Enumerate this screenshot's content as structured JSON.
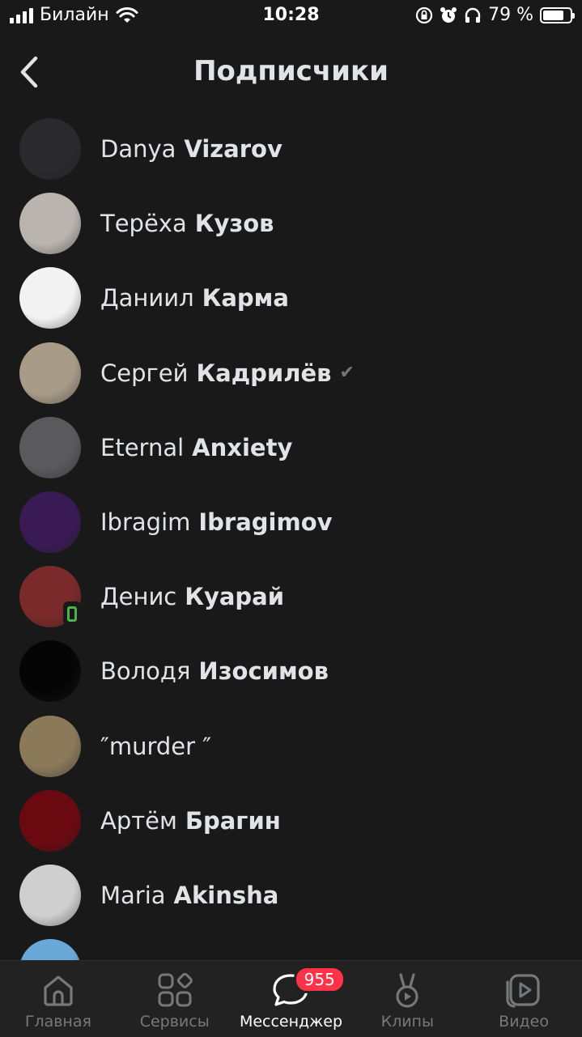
{
  "status_bar": {
    "carrier": "Билайн",
    "time": "10:28",
    "battery_percent": "79 %",
    "battery_level": 0.79
  },
  "header": {
    "title": "Подписчики"
  },
  "followers": [
    {
      "first": "Danya",
      "last": "Vizarov",
      "avatar_color": "#2a2a2c"
    },
    {
      "first": "Терёха",
      "last": "Кузов",
      "avatar_color": "#b9b4ae"
    },
    {
      "first": "Даниил",
      "last": "Карма",
      "avatar_color": "#f2f2f2"
    },
    {
      "first": "Сергей",
      "last": "Кадрилёв",
      "verified": true,
      "avatar_color": "#a89c88"
    },
    {
      "first": "Eternal",
      "last": "Anxiety",
      "avatar_color": "#5a5a5c"
    },
    {
      "first": "Ibragim",
      "last": "Ibragimov",
      "avatar_color": "#3a1a55"
    },
    {
      "first": "Денис",
      "last": "Куарай",
      "online_mobile": true,
      "avatar_color": "#7a2a2a"
    },
    {
      "first": "Володя",
      "last": "Изосимов",
      "avatar_color": "#050505"
    },
    {
      "first": "″murder ″",
      "last": "",
      "avatar_color": "#8a7a5a"
    },
    {
      "first": "Артём",
      "last": "Брагин",
      "avatar_color": "#6a0a10"
    },
    {
      "first": "Maria",
      "last": "Akinsha",
      "avatar_color": "#cfcfcf"
    },
    {
      "first": "",
      "last": "",
      "avatar_color": "#6aa8d8"
    }
  ],
  "tabbar": {
    "tabs": [
      {
        "label": "Главная",
        "icon": "home-icon"
      },
      {
        "label": "Сервисы",
        "icon": "services-icon"
      },
      {
        "label": "Мессенджер",
        "icon": "messenger-icon",
        "active": true,
        "badge": "955"
      },
      {
        "label": "Клипы",
        "icon": "clips-icon"
      },
      {
        "label": "Видео",
        "icon": "video-icon"
      }
    ]
  },
  "colors": {
    "background": "#19191a",
    "text": "#e1e3e6",
    "secondary": "#76787a",
    "badge": "#ff3347",
    "online": "#4bb34b"
  }
}
